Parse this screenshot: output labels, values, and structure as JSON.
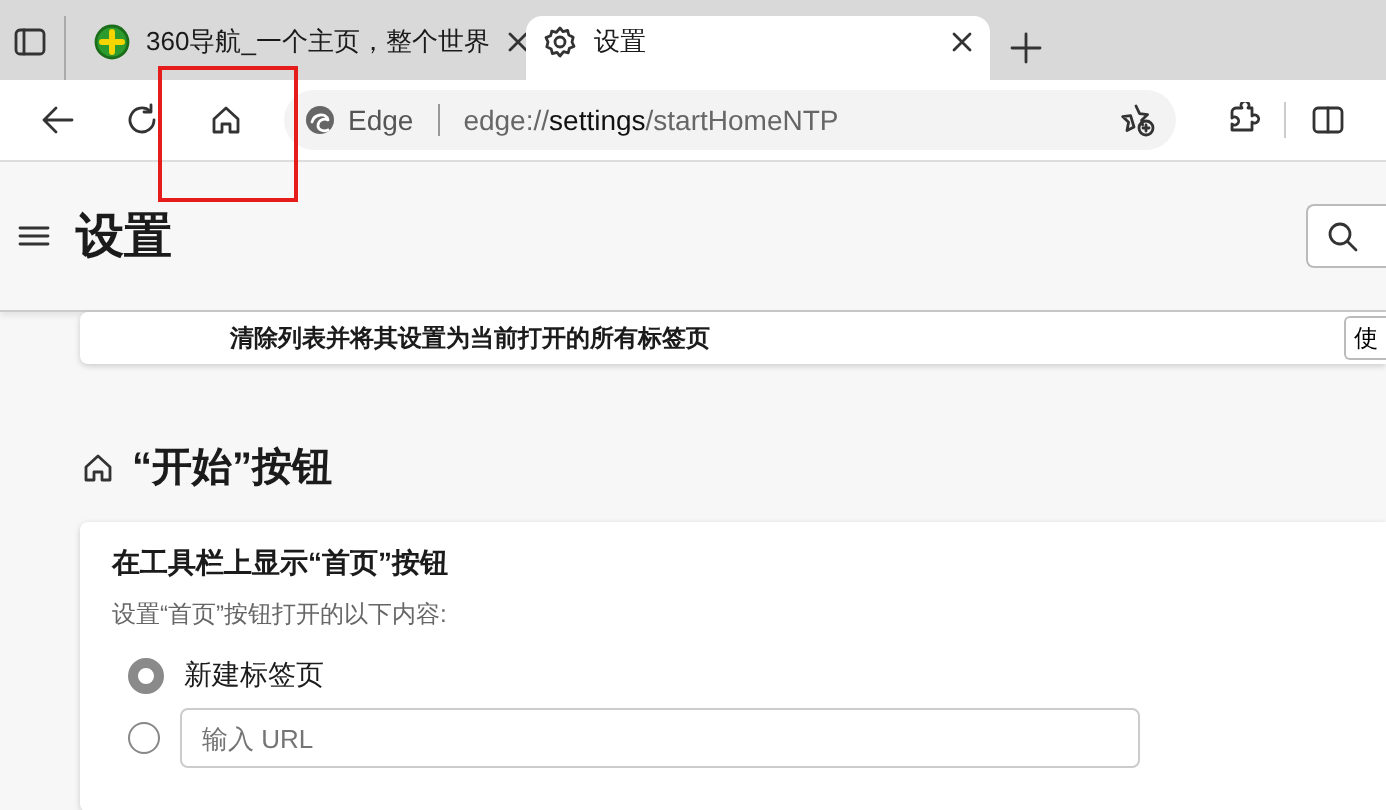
{
  "tabs": [
    {
      "title": "360导航_一个主页，整个世界",
      "kind": "site",
      "selected": false
    },
    {
      "title": "设置",
      "kind": "settings",
      "selected": true
    }
  ],
  "address_bar": {
    "site_label": "Edge",
    "url_scheme": "edge://",
    "url_host": "settings",
    "url_path": "/startHomeNTP"
  },
  "page_header": {
    "title": "设置"
  },
  "previous_card": {
    "text": "清除列表并将其设置为当前打开的所有标签页",
    "button": "使"
  },
  "section": {
    "title": "“开始”按钮",
    "card": {
      "title": "在工具栏上显示“首页”按钮",
      "description": "设置“首页”按钮打开的以下内容:",
      "options": [
        {
          "kind": "label",
          "label": "新建标签页",
          "selected": true
        },
        {
          "kind": "url",
          "placeholder": "输入 URL",
          "selected": false
        }
      ]
    }
  }
}
